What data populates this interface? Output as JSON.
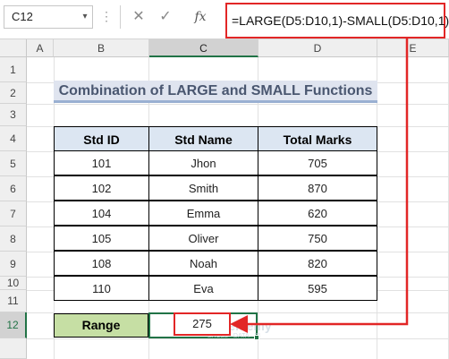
{
  "formula_bar": {
    "name_box": "C12",
    "formula": "=LARGE(D5:D10,1)-SMALL(D5:D10,1)",
    "fx_label": "fx",
    "cancel_glyph": "✕",
    "enter_glyph": "✓",
    "dots_glyph": "⋮"
  },
  "columns": [
    "A",
    "B",
    "C",
    "D",
    "E"
  ],
  "rows": [
    "1",
    "2",
    "3",
    "4",
    "5",
    "6",
    "7",
    "8",
    "9",
    "10",
    "11",
    "12"
  ],
  "selected_column": "C",
  "selected_row": "12",
  "title": "Combination of LARGE and SMALL Functions",
  "table": {
    "headers": [
      "Std ID",
      "Std Name",
      "Total Marks"
    ],
    "rows": [
      [
        "101",
        "Jhon",
        "705"
      ],
      [
        "102",
        "Smith",
        "870"
      ],
      [
        "104",
        "Emma",
        "620"
      ],
      [
        "105",
        "Oliver",
        "750"
      ],
      [
        "108",
        "Noah",
        "820"
      ],
      [
        "110",
        "Eva",
        "595"
      ]
    ]
  },
  "range": {
    "label": "Range",
    "value": "275"
  },
  "watermark": {
    "text": "exceldemy",
    "sub": "EXCEL · DATA · BI"
  },
  "colors": {
    "accent_green": "#217346",
    "highlight_red": "#e22626",
    "header_fill": "#dce6f2",
    "range_fill": "#c6dfa4"
  }
}
